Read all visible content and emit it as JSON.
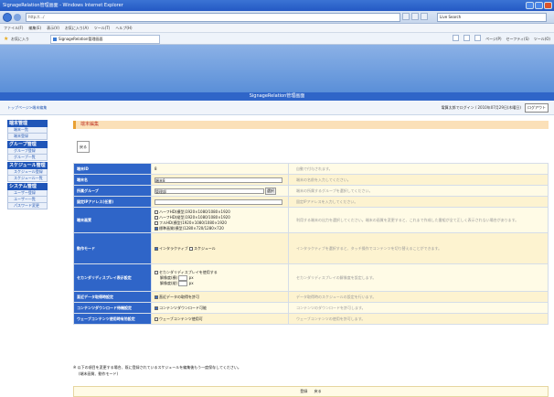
{
  "window": {
    "title": "SignageRelation管理画面 - Windows Internet Explorer"
  },
  "addressbar": {
    "url": "http://.../",
    "search_placeholder": "Live Search"
  },
  "menubar": {
    "items": [
      "ファイル(F)",
      "編集(E)",
      "表示(V)",
      "お気に入り(A)",
      "ツール(T)",
      "ヘルプ(H)"
    ]
  },
  "favbar": {
    "label": "お気に入り",
    "tab_title": "SignageRelation管理画面",
    "commands": [
      "ページ(P)",
      "セーフティ(S)",
      "ツール(O)"
    ]
  },
  "header": {
    "title": "SignageRelation管理画面"
  },
  "subbar": {
    "breadcrumb": "トップページ>端末編集",
    "user_info": "電算太郎でログイン / 2010年07月29日(木曜日)",
    "logout_label": "ログアウト"
  },
  "sidebar": {
    "sections": [
      {
        "head": "端末管理",
        "items": [
          "端末一覧",
          "端末登録"
        ]
      },
      {
        "head": "グループ管理",
        "items": [
          "グループ登録",
          "グループ一覧"
        ]
      },
      {
        "head": "スケジュール管理",
        "items": [
          "スケジュール登録",
          "スケジュール一覧"
        ]
      },
      {
        "head": "システム管理",
        "items": [
          "ユーザー登録",
          "ユーザー一覧",
          "パスワード変更"
        ]
      }
    ]
  },
  "main": {
    "title": "端末編集",
    "back_label": "戻る",
    "rows": [
      {
        "label": "端末ID",
        "value": "8",
        "desc": "自動で付与されます。"
      },
      {
        "label": "端末名",
        "value": "端末8",
        "desc": "端末の名前を入力してください。"
      },
      {
        "label": "所属グループ",
        "value": "管理部",
        "button": "選択",
        "desc": "端末の所属するグループを選択してください。"
      },
      {
        "label": "固定IPアドレス(任意)",
        "value": "",
        "desc": "固定IPアドレスを入力してください。"
      },
      {
        "label": "端末画質",
        "options": [
          "ハーフHD(横型)1920×1080/1080×1920",
          "ハーフHD(縦型)1920×1080/1080×1920",
          "フルHD(横型)1920×1080/1080×1920",
          "標準画質(横型)1280×720/1280×720"
        ],
        "desc": "利用する端末の出力を選択してください。端末の画質を変更すると、これまで作成した番組が全て正しく表示されない場合があります。"
      },
      {
        "label": "動作モード",
        "options": [
          "インタラクティブ",
          "スケジュール"
        ],
        "desc": "インタラクティブを選択すると、タッチ操作でコンテンツを切り替えることができます。"
      },
      {
        "label": "セカンダリディスプレイ表示設定",
        "check_label": "セカンダリディスプレイを使用する",
        "sub": [
          "解像度(横)",
          "解像度(縦)"
        ],
        "desc": "セカンダリディスプレイの解像度を設定します。"
      },
      {
        "label": "直近データ取得時設定",
        "check_label": "直近データの取得を許可",
        "desc": "データ取得時のスケジュールの設定を行います。"
      },
      {
        "label": "コンテンツダウンロード待機設定",
        "check_label": "コンテンツダウンロード可能",
        "desc": "コンテンツのダウンロードを許可します。"
      },
      {
        "label": "ウェーブコンテンツ使用時有効設定",
        "check_label": "ウェーブコンテンツ使用可",
        "desc": "ウェーブコンテンツの使用を許可します。"
      }
    ],
    "note_line1": "※ 以下の項目を変更する場合、既に登録されているスケジュールを編集後もう一度保存してください。",
    "note_line2": "(端末画質、動作モード)",
    "bottom_buttons": [
      "登録",
      "戻る"
    ]
  }
}
